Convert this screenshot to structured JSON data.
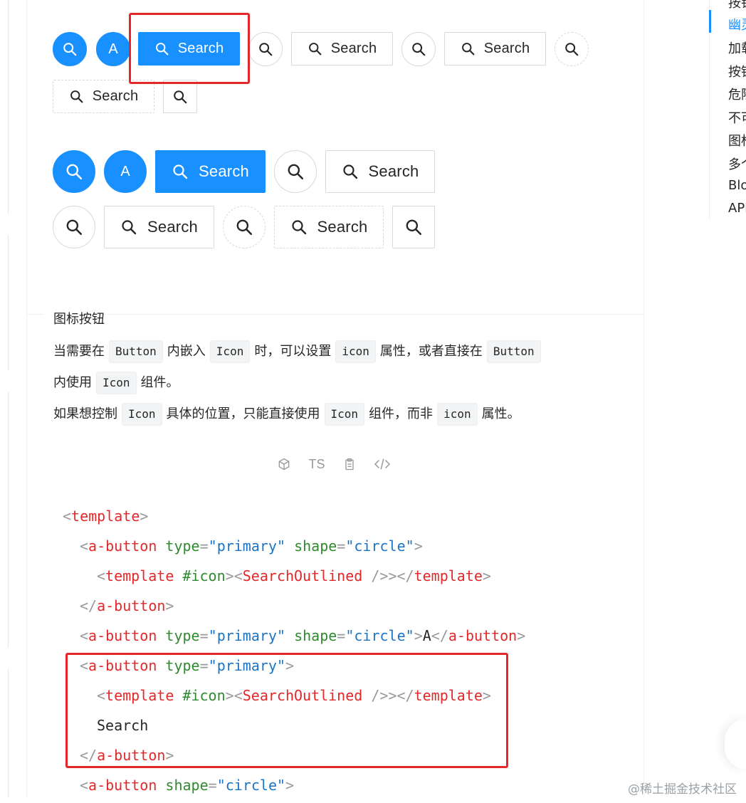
{
  "buttons": {
    "search_label": "Search",
    "letter_label": "A"
  },
  "section": {
    "title": "图标按钮",
    "line1": {
      "t1": "当需要在",
      "c1": "Button",
      "t2": "内嵌入",
      "c2": "Icon",
      "t3": "时，可以设置",
      "c3": "icon",
      "t4": "属性，或者直接在",
      "c4": "Button"
    },
    "line2": {
      "t1": "内使用",
      "c1": "Icon",
      "t2": "组件。"
    },
    "line3": {
      "t1": "如果想控制",
      "c1": "Icon",
      "t2": "具体的位置，只能直接使用",
      "c2": "Icon",
      "t3": "组件，而非",
      "c3": "icon",
      "t4": "属性。"
    }
  },
  "code_actions": {
    "ts_label": "TS"
  },
  "code": {
    "lt": "<",
    "gt": ">",
    "lt_slash": "</",
    "self_close": " />",
    "eq": "=",
    "quote": "\"",
    "template": "template",
    "a_button": "a-button",
    "type_attr": "type",
    "shape_attr": "shape",
    "primary": "primary",
    "circle": "circle",
    "icon_slot": "#icon",
    "search_outlined": "SearchOutlined",
    "letter": "A",
    "search_text": "Search"
  },
  "toc": {
    "items": [
      "按钮",
      "幽灵",
      "加载",
      "按钮",
      "危险",
      "不可",
      "图标",
      "多个",
      "Blo",
      "API"
    ]
  },
  "watermark": "@稀土掘金技术社区",
  "colors": {
    "primary": "#1890ff",
    "highlight": "#e4282a",
    "tag": "#e4282a",
    "attr": "#2f8a2f",
    "value": "#1b74c4"
  }
}
